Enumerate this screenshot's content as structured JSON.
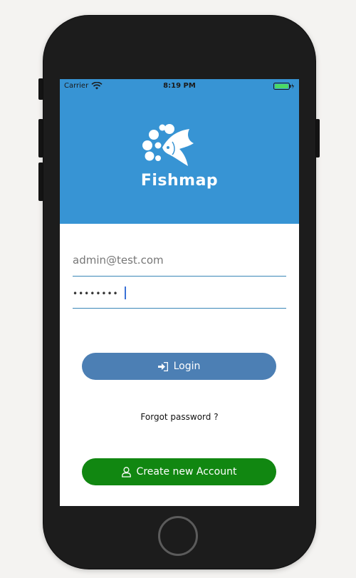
{
  "status_bar": {
    "carrier": "Carrier",
    "time": "8:19 PM",
    "battery_color": "#4cd964"
  },
  "header": {
    "app_name": "Fishmap",
    "background_color": "#3794d4",
    "logo_icon": "fish-bubbles-icon"
  },
  "form": {
    "email_placeholder": "admin@test.com",
    "password_value": "••••••••"
  },
  "buttons": {
    "login_label": "Login",
    "login_icon": "sign-in-icon",
    "login_color": "#4c7fb4",
    "forgot_label": "Forgot password ?",
    "create_label": "Create new Account",
    "create_icon": "user-icon",
    "create_color": "#118711"
  }
}
